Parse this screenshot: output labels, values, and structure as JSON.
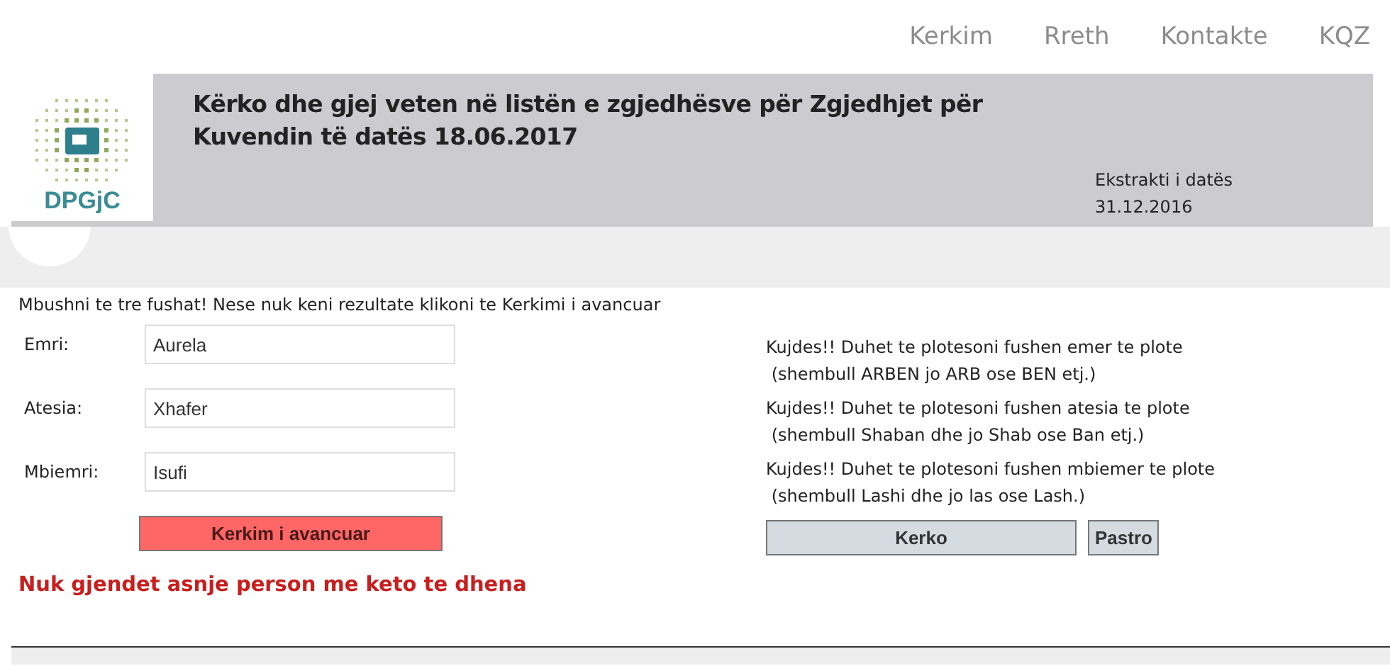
{
  "nav": {
    "links": [
      "Kerkim",
      "Rreth",
      "Kontakte",
      "KQZ"
    ]
  },
  "header": {
    "logo_text": "DPGjC",
    "title_line1": "Kërko dhe gjej veten në listën e zgjedhësve për Zgjedhjet për",
    "title_line2": "Kuvendin të datës 18.06.2017",
    "extract_label": "Ekstrakti i datës",
    "extract_date": "31.12.2016"
  },
  "form": {
    "instruction": "Mbushni te tre fushat! Nese nuk keni rezultate klikoni te Kerkimi i avancuar",
    "fields": [
      {
        "label": "Emri:",
        "value": "Aurela"
      },
      {
        "label": "Atesia:",
        "value": "Xhafer"
      },
      {
        "label": "Mbiemri:",
        "value": "Isufi"
      }
    ],
    "advanced_button": "Kerkim i avancuar",
    "error": "Nuk gjendet asnje person me keto te dhena",
    "hints": [
      {
        "line1": "Kujdes!! Duhet te plotesoni fushen emer te plote",
        "line2": "(shembull ARBEN jo ARB ose BEN etj.)"
      },
      {
        "line1": "Kujdes!! Duhet te plotesoni fushen atesia te plote",
        "line2": "(shembull Shaban dhe jo Shab ose Ban etj.)"
      },
      {
        "line1": "Kujdes!! Duhet te plotesoni fushen mbiemer te plote",
        "line2": "(shembull Lashi dhe jo las ose Lash.)"
      }
    ],
    "search_button": "Kerko",
    "clear_button": "Pastro"
  }
}
